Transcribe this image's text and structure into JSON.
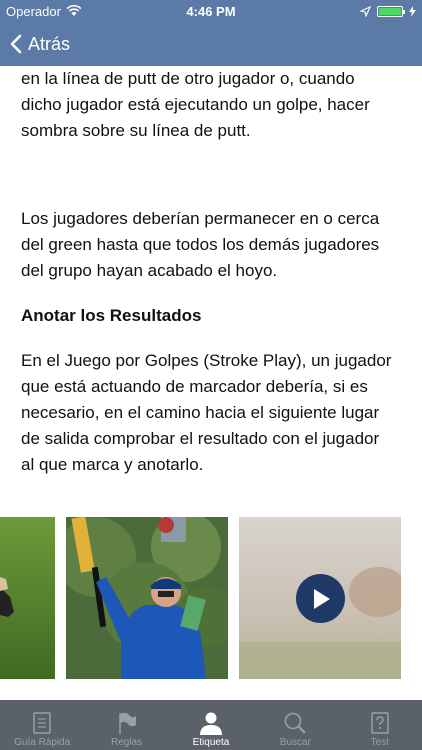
{
  "status": {
    "carrier": "Operador",
    "time": "4:46 PM",
    "battery_fraction": 1.0
  },
  "nav": {
    "back_label": "Atrás"
  },
  "article": {
    "paragraph1_lines": [
      "en la línea de putt de otro jugador o, cuando",
      "dicho jugador está ejecutando un golpe, hacer",
      "sombra sobre su línea de putt."
    ],
    "paragraph2_lines": [
      "Los jugadores deberían permanecer en o cerca",
      "del green hasta que todos los demás jugadores",
      "del grupo hayan acabado el hoyo."
    ],
    "heading": "Anotar los Resultados",
    "paragraph3_lines": [
      "En el Juego por Golpes (Stroke Play), un jugador",
      "que está actuando de marcador debería, si es",
      "necesario, en el camino hacia el siguiente lugar",
      "de salida comprobar el resultado con el jugador",
      "al que marca y anotarlo."
    ]
  },
  "gallery": {
    "items": [
      {
        "kind": "photo",
        "subject": "golfer-on-green"
      },
      {
        "kind": "photo",
        "subject": "referee-with-flag-pole"
      },
      {
        "kind": "video",
        "subject": "golf-course-video"
      }
    ],
    "play_icon": "play-icon"
  },
  "tabs": [
    {
      "label": "Guía Rápida",
      "icon": "book-icon",
      "active": false
    },
    {
      "label": "Reglas",
      "icon": "flag-icon",
      "active": false
    },
    {
      "label": "Etiqueta",
      "icon": "person-icon",
      "active": true
    },
    {
      "label": "Buscar",
      "icon": "search-icon",
      "active": false
    },
    {
      "label": "Test",
      "icon": "question-icon",
      "active": false
    }
  ],
  "colors": {
    "bar": "#5b7aa6",
    "tabbar": "#5b6168",
    "tab_active": "#ffffff",
    "tab_inactive": "#9aa0a6",
    "play_button": "#1f3a66",
    "battery": "#4cd964"
  }
}
